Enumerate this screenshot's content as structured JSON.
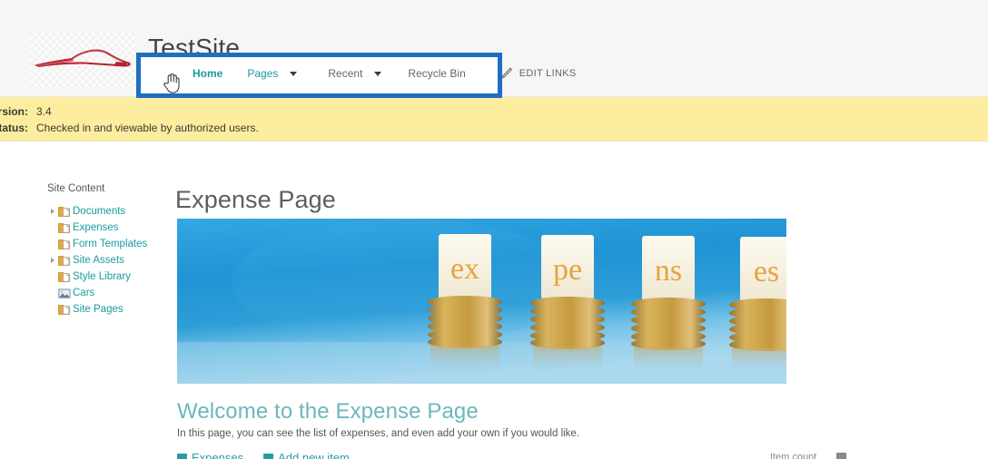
{
  "header": {
    "site_title": "TestSite",
    "logo_icon": "car-silhouette-logo",
    "nav": {
      "items": [
        {
          "label": "Home",
          "state": "selected",
          "caret": false
        },
        {
          "label": "Pages",
          "state": "current",
          "caret": true
        },
        {
          "label": "Recent",
          "state": "plain",
          "caret": true
        },
        {
          "label": "Recycle Bin",
          "state": "plain",
          "caret": false
        }
      ],
      "edit_links_label": "EDIT LINKS",
      "edit_links_icon": "pencil-icon",
      "highlight_color": "#1d6fc4"
    },
    "cursor_icon": "hand-pointer-cursor"
  },
  "status_bar": {
    "background_color": "#fcee9e",
    "rows": [
      {
        "key": "Version:",
        "value": "3.4"
      },
      {
        "key": "Status:",
        "value": "Checked in and viewable by authorized users."
      }
    ]
  },
  "quicklaunch": {
    "header": "Site Content",
    "items": [
      {
        "label": "Documents",
        "icon": "document-library-icon",
        "expandable": true
      },
      {
        "label": "Expenses",
        "icon": "document-library-icon",
        "expandable": false
      },
      {
        "label": "Form Templates",
        "icon": "document-library-icon",
        "expandable": false
      },
      {
        "label": "Site Assets",
        "icon": "document-library-icon",
        "expandable": true
      },
      {
        "label": "Style Library",
        "icon": "document-library-icon",
        "expandable": false
      },
      {
        "label": "Cars",
        "icon": "picture-library-icon",
        "expandable": false
      },
      {
        "label": "Site Pages",
        "icon": "document-library-icon",
        "expandable": false
      }
    ],
    "link_color": "#1a9ba1"
  },
  "main": {
    "page_title": "Expense Page",
    "banner": {
      "alt": "Four stacks of gold coins each topped with a card spelling ex pe ns es on a blue background",
      "card_text": [
        "ex",
        "pe",
        "ns",
        "es"
      ],
      "card_color": "#e8a33d",
      "background_color": "#2197d8"
    },
    "welcome_heading": "Welcome to the Expense Page",
    "welcome_heading_color": "#6cb7bd",
    "welcome_text": "In this page, you can see the list of expenses, and even add your own if you would like.",
    "clipped_bottom": {
      "left_label": "Expenses",
      "left_label_2": "Add new item",
      "right_label": "Item count"
    }
  }
}
